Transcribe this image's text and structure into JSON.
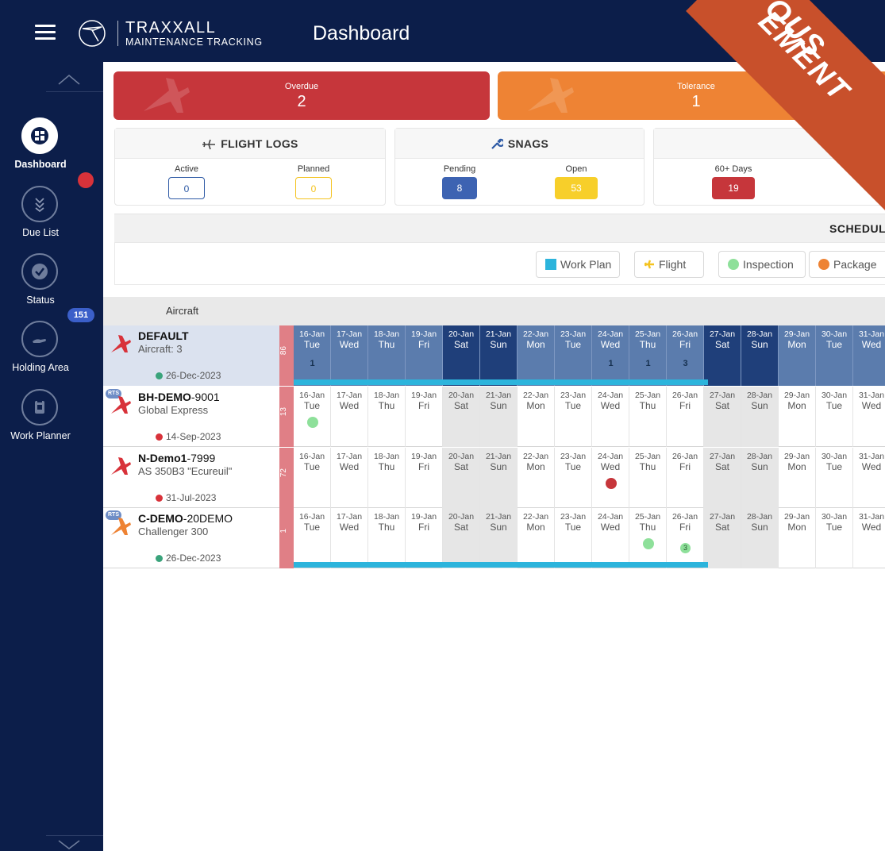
{
  "header": {
    "brand_name": "TRAXXALL",
    "brand_sub": "MAINTENANCE TRACKING",
    "page_title": "Dashboard"
  },
  "sidebar": {
    "items": [
      {
        "label": "Dashboard",
        "icon": "dashboard-icon"
      },
      {
        "label": "Due List",
        "icon": "due-list-icon"
      },
      {
        "label": "Status",
        "icon": "status-check-icon"
      },
      {
        "label": "Holding Area",
        "icon": "holding-hand-icon",
        "badge": "151"
      },
      {
        "label": "Work Planner",
        "icon": "work-planner-clipboard-icon"
      }
    ]
  },
  "alerts": {
    "overdue": {
      "label": "Overdue",
      "value": "2"
    },
    "tolerance": {
      "label": "Tolerance",
      "value": "1"
    }
  },
  "flight_logs": {
    "title": "FLIGHT LOGS",
    "active_label": "Active",
    "active_value": "0",
    "planned_label": "Planned",
    "planned_value": "0"
  },
  "snags": {
    "title": "SNAGS",
    "pending_label": "Pending",
    "pending_value": "8",
    "open_label": "Open",
    "open_value": "53"
  },
  "expiry": {
    "days60_label": "60+ Days",
    "days60_value": "19"
  },
  "schedule": {
    "title": "SCHEDUL",
    "legend": [
      "Work Plan",
      "Flight",
      "Inspection",
      "Package"
    ],
    "aircraft_col": "Aircraft"
  },
  "days": [
    {
      "date": "16-Jan",
      "dow": "Tue"
    },
    {
      "date": "17-Jan",
      "dow": "Wed"
    },
    {
      "date": "18-Jan",
      "dow": "Thu"
    },
    {
      "date": "19-Jan",
      "dow": "Fri"
    },
    {
      "date": "20-Jan",
      "dow": "Sat"
    },
    {
      "date": "21-Jan",
      "dow": "Sun"
    },
    {
      "date": "22-Jan",
      "dow": "Mon"
    },
    {
      "date": "23-Jan",
      "dow": "Tue"
    },
    {
      "date": "24-Jan",
      "dow": "Wed"
    },
    {
      "date": "25-Jan",
      "dow": "Thu"
    },
    {
      "date": "26-Jan",
      "dow": "Fri"
    },
    {
      "date": "27-Jan",
      "dow": "Sat"
    },
    {
      "date": "28-Jan",
      "dow": "Sun"
    },
    {
      "date": "29-Jan",
      "dow": "Mon"
    },
    {
      "date": "30-Jan",
      "dow": "Tue"
    },
    {
      "date": "31-Jan",
      "dow": "Wed"
    }
  ],
  "aircraft": [
    {
      "name_bold": "DEFAULT",
      "name_rest": "",
      "model": "Aircraft: 3",
      "date": "26-Dec-2023",
      "date_status": "#3aa37b",
      "strip": "86",
      "rts": "",
      "counts": {
        "0": "1",
        "8": "1",
        "9": "1",
        "10": "3"
      }
    },
    {
      "name_bold": "BH-DEMO",
      "name_rest": "-9001",
      "model": "Global Express",
      "date": "14-Sep-2023",
      "date_status": "#d8323a",
      "strip": "13",
      "rts": "RTS",
      "markers": {
        "0": "#8ee09a"
      }
    },
    {
      "name_bold": "N-Demo1",
      "name_rest": "-7999",
      "model": "AS 350B3 \"Ecureuil\"",
      "date": "31-Jul-2023",
      "date_status": "#d8323a",
      "strip": "72",
      "rts": "",
      "markers": {
        "8": "#c6363b"
      }
    },
    {
      "name_bold": "C-DEMO",
      "name_rest": "-20DEMO",
      "model": "Challenger 300",
      "date": "26-Dec-2023",
      "date_status": "#3aa37b",
      "strip": "1",
      "rts": "RTS",
      "markers": {
        "9": "#8ee09a"
      },
      "badges": {
        "10": "3"
      }
    }
  ],
  "ribbon": {
    "line1": "OUS",
    "line2": "EMENT"
  },
  "colors": {
    "navy": "#0c1e4a",
    "overdue": "#c6363b",
    "tolerance": "#ee8334",
    "work_plan": "#2cb4dc",
    "flight": "#f4c320",
    "inspection": "#8ee09a",
    "package": "#ee8334"
  }
}
